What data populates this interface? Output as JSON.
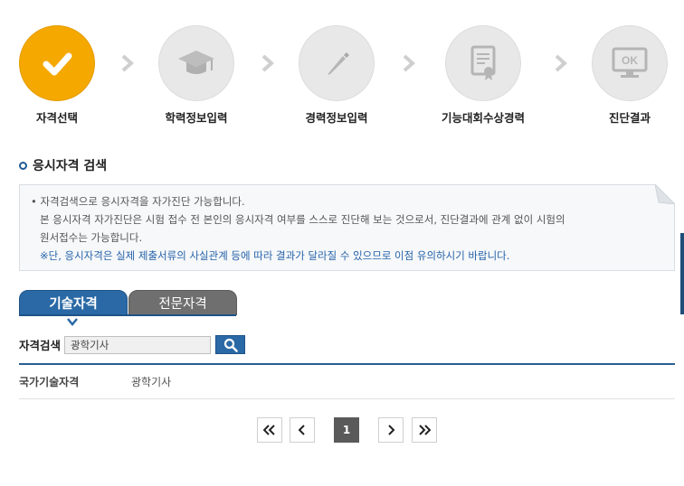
{
  "steps": [
    {
      "label": "자격선택",
      "icon": "checkmark-icon",
      "active": true
    },
    {
      "label": "학력정보입력",
      "icon": "graduation-cap-icon",
      "active": false
    },
    {
      "label": "경력정보입력",
      "icon": "pencil-icon",
      "active": false
    },
    {
      "label": "기능대회수상경력",
      "icon": "certificate-icon",
      "active": false
    },
    {
      "label": "진단결과",
      "icon": "ok-monitor-icon",
      "active": false
    }
  ],
  "section": {
    "title": "응시자격 검색"
  },
  "notice": {
    "line1": "• 자격검색으로 응시자격을 자가진단 가능합니다.",
    "line2": "본 응시자격 자가진단은 시험 접수 전 본인의 응시자격 여부를 스스로 진단해 보는 것으로서, 진단결과에 관계 없이 시험의",
    "line3": "원서접수는 가능합니다.",
    "line4": "※단, 응시자격은 실제 제출서류의 사실관계 등에 따라 결과가 달라질 수 있으므로 이점 유의하시기 바랍니다."
  },
  "tabs": [
    {
      "label": "기술자격",
      "active": true
    },
    {
      "label": "전문자격",
      "active": false
    }
  ],
  "search": {
    "label": "자격검색",
    "value": "광학기사",
    "button_icon": "search-icon"
  },
  "results": [
    {
      "category": "국가기술자격",
      "name": "광학기사"
    }
  ],
  "pagination": {
    "first": "«",
    "prev": "‹",
    "current": "1",
    "next": "›",
    "last": "»"
  },
  "colors": {
    "active_step": "#f5a800",
    "primary": "#2a69a5",
    "inactive_tab": "#6f6f6f",
    "notice_blue": "#2563a8"
  }
}
